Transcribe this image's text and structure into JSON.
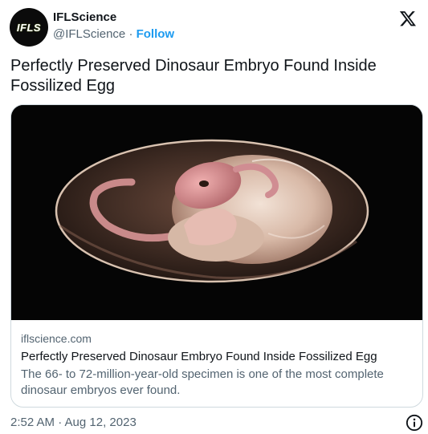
{
  "author": {
    "display_name": "IFLScience",
    "handle": "@IFLScience",
    "separator": "·",
    "follow_label": "Follow",
    "avatar_text": "IFLS"
  },
  "tweet": {
    "text": "Perfectly Preserved Dinosaur Embryo Found Inside Fossilized Egg"
  },
  "card": {
    "domain": "iflscience.com",
    "title": "Perfectly Preserved Dinosaur Embryo Found Inside Fossilized Egg",
    "description": "The 66- to 72-million-year-old specimen is one of the most complete dinosaur embryos ever found.",
    "image_icon": "dinosaur-embryo-illustration"
  },
  "footer": {
    "timestamp": "2:52 AM · Aug 12, 2023"
  },
  "icons": {
    "brand": "x-logo-icon",
    "info": "info-icon"
  },
  "colors": {
    "accent": "#1d9bf0",
    "text_primary": "#0f1419",
    "text_secondary": "#536471",
    "border": "#cfd9de",
    "avatar_accent": "#b6e23a"
  }
}
